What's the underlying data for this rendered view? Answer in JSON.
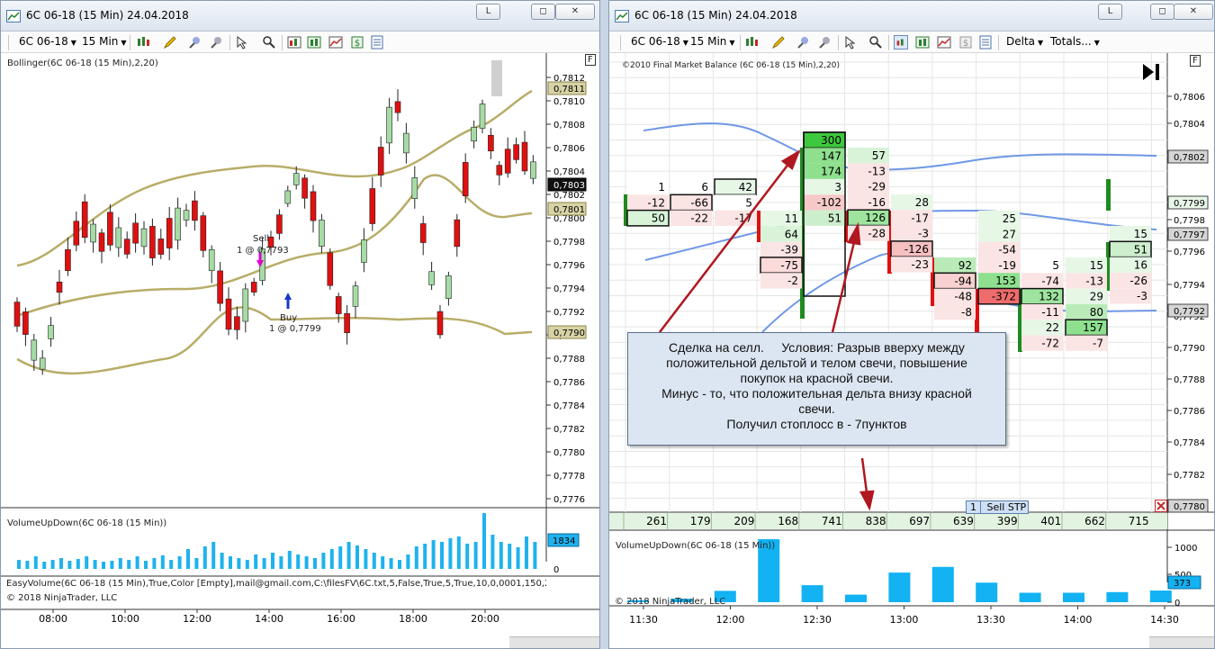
{
  "left_window": {
    "title": "6C 06-18 (15 Min)  24.04.2018",
    "buttons": {
      "minimize": "L",
      "restore": "◻",
      "close": "✕"
    },
    "toolbar": {
      "instrument": "6C 06-18",
      "interval": "15 Min"
    },
    "indicator_label": "Bollinger(6C 06-18 (15 Min),2,20)",
    "flag_box": "F",
    "price_axis": [
      "0,7812",
      "0,7810",
      "0,7808",
      "0,7806",
      "0,7804",
      "0,7802",
      "0,7800",
      "0,7798",
      "0,7796",
      "0,7794",
      "0,7792",
      "0,7790",
      "0,7788",
      "0,7786",
      "0,7784",
      "0,7782",
      "0,7780",
      "0,7778",
      "0,7776"
    ],
    "price_tags": {
      "upper": "0,7811",
      "last": "0,7803",
      "middle": "0,7801",
      "lower": "0,7790"
    },
    "trades": {
      "sell_label": "Sell",
      "sell_detail": "1 @ 0,7793",
      "buy_label": "Buy",
      "buy_detail": "1 @ 0,7799"
    },
    "volume_label": "VolumeUpDown(6C 06-18 (15 Min))",
    "volume_axis_zero": "0",
    "volume_tag": "1834",
    "easyvolume_label": "EasyVolume(6C 06-18 (15 Min),True,Color [Empty],mail@gmail.com,C:\\filesFV\\6C.txt,5,False,True,5,True,10,0,0001,150,2",
    "copyright": "© 2018 NinjaTrader, LLC",
    "time_axis": [
      "08:00",
      "10:00",
      "12:00",
      "14:00",
      "16:00",
      "18:00",
      "20:00"
    ]
  },
  "right_window": {
    "title": "6C 06-18 (15 Min)  24.04.2018",
    "buttons": {
      "minimize": "L",
      "restore": "◻",
      "close": "✕"
    },
    "toolbar": {
      "instrument": "6C 06-18",
      "interval": "15 Min",
      "delta": "Delta",
      "totals": "Totals..."
    },
    "indicator_label": "©2010 Final Market Balance  (6C 06-18 (15 Min),2,20)",
    "flag_box": "F",
    "price_axis": [
      "0,7806",
      "0,7804",
      "0,7802",
      "0,7800",
      "0,7799",
      "0,7798",
      "0,7797",
      "0,7796",
      "0,7794",
      "0,7792",
      "0,7790",
      "0,7788",
      "0,7786",
      "0,7784",
      "0,7782",
      "0,7780"
    ],
    "price_tags": {
      "p1": "0,7802",
      "p2": "0,7799",
      "p3": "0,7797",
      "p4": "0,7792",
      "p5": "0,7780"
    },
    "order_tag": {
      "qty": "1",
      "label": "Sell STP"
    },
    "totals_row": [
      "261",
      "179",
      "209",
      "168",
      "741",
      "838",
      "697",
      "639",
      "399",
      "401",
      "662",
      "715"
    ],
    "annotation_lines": [
      "Сделка на селл.     Условия: Разрыв вверху между",
      "положительной дельтой и телом свечи, повышение",
      "покупок на красной свечи.",
      "Минус - то, что положительная дельта внизу красной",
      "свечи.",
      "Получил стоплосс в - 7пунктов"
    ],
    "volume_label": "VolumeUpDown(6C 06-18 (15 Min))",
    "volume_axis": [
      "1000",
      "500",
      "0"
    ],
    "volume_tag": "373",
    "copyright": "© 2018 NinjaTrader, LLC",
    "time_axis": [
      "11:30",
      "12:00",
      "12:30",
      "13:00",
      "13:30",
      "14:00",
      "14:30"
    ]
  },
  "footprint": [
    [
      {
        "v": "1",
        "b": "#ffffff"
      },
      {
        "v": "-12",
        "b": "#fbe4e4"
      },
      {
        "v": "50",
        "b": "#d8f3d8",
        "box": 1
      }
    ],
    [
      {
        "v": "6",
        "b": "#ffffff"
      },
      {
        "v": "-66",
        "b": "#fbe4e4",
        "box": 1
      },
      {
        "v": "-22",
        "b": "#fbe4e4"
      }
    ],
    [
      {
        "v": "42",
        "b": "#e6f7e6",
        "box": 1
      },
      {
        "v": "5",
        "b": "#ffffff"
      },
      {
        "v": "-17",
        "b": "#fbe4e4"
      }
    ],
    [
      {
        "v": "11",
        "b": "#e6f7e6"
      },
      {
        "v": "64",
        "b": "#d8f3d8"
      },
      {
        "v": "-39",
        "b": "#fbe4e4"
      },
      {
        "v": "-75",
        "b": "#fbdada",
        "box": 1
      },
      {
        "v": "-2",
        "b": "#fbe4e4"
      }
    ],
    [
      {
        "v": "300",
        "b": "#3ec83e",
        "box": 1
      },
      {
        "v": "147",
        "b": "#8ee08e"
      },
      {
        "v": "174",
        "b": "#8ee08e"
      },
      {
        "v": "3",
        "b": "#e6f7e6"
      },
      {
        "v": "-102",
        "b": "#f6c9c9"
      },
      {
        "v": "51",
        "b": "#cdeecd"
      }
    ],
    [
      {
        "v": "57",
        "b": "#d8f3d8"
      },
      {
        "v": "-13",
        "b": "#fbe4e4"
      },
      {
        "v": "-29",
        "b": "#fbe4e4"
      },
      {
        "v": "-16",
        "b": "#fbe4e4"
      },
      {
        "v": "126",
        "b": "#9ee49e",
        "box": 1
      },
      {
        "v": "-28",
        "b": "#fbe4e4"
      }
    ],
    [
      {
        "v": "28",
        "b": "#e6f7e6"
      },
      {
        "v": "-17",
        "b": "#fbe4e4"
      },
      {
        "v": "-3",
        "b": "#fbe4e4"
      },
      {
        "v": "-126",
        "b": "#f6c0c0",
        "box": 1
      },
      {
        "v": "-23",
        "b": "#fbe4e4"
      }
    ],
    [
      {
        "v": "92",
        "b": "#b9ebb9"
      },
      {
        "v": "-94",
        "b": "#f8d0d0",
        "box": 1
      },
      {
        "v": "-48",
        "b": "#fbe4e4"
      },
      {
        "v": "-8",
        "b": "#fbe4e4"
      }
    ],
    [
      {
        "v": "25",
        "b": "#e6f7e6"
      },
      {
        "v": "27",
        "b": "#e6f7e6"
      },
      {
        "v": "-54",
        "b": "#fbe4e4"
      },
      {
        "v": "-19",
        "b": "#fbe4e4"
      },
      {
        "v": "153",
        "b": "#8ee08e"
      },
      {
        "v": "-372",
        "b": "#ef6c6c",
        "box": 1
      }
    ],
    [
      {
        "v": "5",
        "b": "#ffffff"
      },
      {
        "v": "-74",
        "b": "#fbe4e4"
      },
      {
        "v": "132",
        "b": "#9ee49e",
        "box": 1
      },
      {
        "v": "-11",
        "b": "#fbe4e4"
      },
      {
        "v": "22",
        "b": "#e6f7e6"
      },
      {
        "v": "-72",
        "b": "#fbe4e4"
      }
    ],
    [
      {
        "v": "15",
        "b": "#e6f7e6"
      },
      {
        "v": "-13",
        "b": "#fbe4e4"
      },
      {
        "v": "29",
        "b": "#e6f7e6"
      },
      {
        "v": "80",
        "b": "#b9ebb9"
      },
      {
        "v": "157",
        "b": "#8ee08e",
        "box": 1
      },
      {
        "v": "-7",
        "b": "#fbe4e4"
      }
    ],
    [
      {
        "v": "15",
        "b": "#e6f7e6"
      },
      {
        "v": "51",
        "b": "#cdeecd",
        "box": 1
      },
      {
        "v": "16",
        "b": "#e6f7e6"
      },
      {
        "v": "-26",
        "b": "#fbe4e4"
      },
      {
        "v": "-3",
        "b": "#fbe4e4"
      }
    ]
  ],
  "right_volume": [
    30,
    55,
    180,
    1000,
    270,
    120,
    470,
    560,
    310,
    150,
    150,
    160,
    185
  ]
}
